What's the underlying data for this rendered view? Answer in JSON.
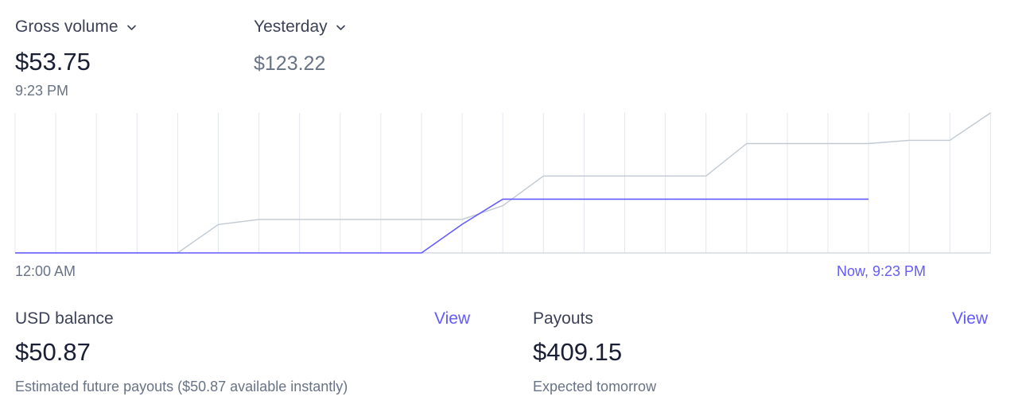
{
  "header": {
    "metric_label": "Gross volume",
    "metric_value": "$53.75",
    "metric_time": "9:23 PM",
    "compare_label": "Yesterday",
    "compare_value": "$123.22"
  },
  "chart_data": {
    "type": "line",
    "x_labels": {
      "start": "12:00 AM",
      "end": "Now, 9:23 PM"
    },
    "grid": true,
    "ylim": [
      0,
      140
    ],
    "series": [
      {
        "role": "today",
        "color": "#635bff",
        "values": [
          0,
          0,
          0,
          0,
          0,
          0,
          0,
          0,
          0,
          0,
          0,
          28.6,
          53.75,
          53.75,
          53.75,
          53.75,
          53.75,
          53.75,
          53.75,
          53.75,
          53.75,
          53.75
        ]
      },
      {
        "role": "yesterday",
        "color": "#c1c9d2",
        "values": [
          0,
          0,
          0,
          0,
          0,
          28.4,
          33.5,
          33.5,
          33.5,
          33.5,
          33.5,
          33.5,
          47.2,
          76.9,
          76.9,
          76.9,
          76.9,
          76.9,
          109.4,
          109.4,
          109.4,
          109.4,
          112.6,
          112.6,
          140
        ]
      }
    ]
  },
  "balance": {
    "title": "USD balance",
    "link": "View",
    "amount": "$50.87",
    "subtitle": "Estimated future payouts ($50.87 available instantly)"
  },
  "payouts": {
    "title": "Payouts",
    "link": "View",
    "amount": "$409.15",
    "subtitle": "Expected tomorrow"
  },
  "colors": {
    "accent": "#635bff",
    "comparison_line": "#c1c9d2",
    "grid": "#e3e8ee",
    "baseline": "#c1c9d2"
  },
  "icons": {
    "metric_dropdown": "chevron-down-icon",
    "compare_dropdown": "chevron-down-icon"
  }
}
